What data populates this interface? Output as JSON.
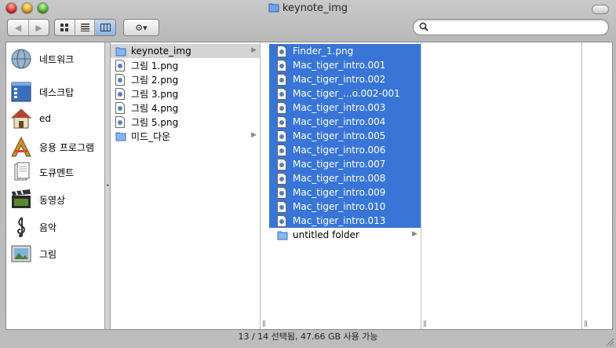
{
  "window": {
    "title": "keynote_img"
  },
  "toolbar": {
    "back_label": "◀",
    "forward_label": "▶",
    "view_buttons": [
      "icon-view",
      "list-view",
      "column-view"
    ],
    "action_label": "⚙▾",
    "search_placeholder": ""
  },
  "sidebar": {
    "items": [
      {
        "label": "네트워크",
        "icon": "network-icon"
      },
      {
        "label": "데스크탑",
        "icon": "desktop-icon"
      },
      {
        "label": "ed",
        "icon": "home-icon"
      },
      {
        "label": "응용 프로그램",
        "icon": "applications-icon"
      },
      {
        "label": "도큐멘트",
        "icon": "documents-icon"
      },
      {
        "label": "동영상",
        "icon": "movies-icon"
      },
      {
        "label": "음악",
        "icon": "music-icon"
      },
      {
        "label": "그림",
        "icon": "pictures-icon"
      }
    ]
  },
  "column1": {
    "items": [
      {
        "label": "keynote_img",
        "type": "folder",
        "state": "grey",
        "arrow": "▶"
      },
      {
        "label": "그림 1.png",
        "type": "file"
      },
      {
        "label": "그림 2.png",
        "type": "file"
      },
      {
        "label": "그림 3.png",
        "type": "file"
      },
      {
        "label": "그림 4.png",
        "type": "file"
      },
      {
        "label": "그림 5.png",
        "type": "file"
      },
      {
        "label": "미드_다운",
        "type": "folder",
        "arrow": "▶"
      }
    ]
  },
  "column2": {
    "items": [
      {
        "label": "Finder_1.png",
        "type": "file",
        "state": "sel"
      },
      {
        "label": "Mac_tiger_intro.001",
        "type": "file",
        "state": "sel"
      },
      {
        "label": "Mac_tiger_intro.002",
        "type": "file",
        "state": "sel"
      },
      {
        "label": "Mac_tiger_...o.002-001",
        "type": "file",
        "state": "sel"
      },
      {
        "label": "Mac_tiger_intro.003",
        "type": "file",
        "state": "sel"
      },
      {
        "label": "Mac_tiger_intro.004",
        "type": "file",
        "state": "sel"
      },
      {
        "label": "Mac_tiger_intro.005",
        "type": "file",
        "state": "sel"
      },
      {
        "label": "Mac_tiger_intro.006",
        "type": "file",
        "state": "sel"
      },
      {
        "label": "Mac_tiger_intro.007",
        "type": "file",
        "state": "sel"
      },
      {
        "label": "Mac_tiger_intro.008",
        "type": "file",
        "state": "sel"
      },
      {
        "label": "Mac_tiger_intro.009",
        "type": "file",
        "state": "sel"
      },
      {
        "label": "Mac_tiger_intro.010",
        "type": "file",
        "state": "sel"
      },
      {
        "label": "Mac_tiger_intro.013",
        "type": "file",
        "state": "sel"
      },
      {
        "label": "untitled folder",
        "type": "folder",
        "arrow": "▶"
      }
    ]
  },
  "status": {
    "text": "13 / 14 선택됨, 47.66 GB 사용 가능"
  },
  "colors": {
    "selection": "#3875d7",
    "parent_selection": "#d4d4d4"
  }
}
